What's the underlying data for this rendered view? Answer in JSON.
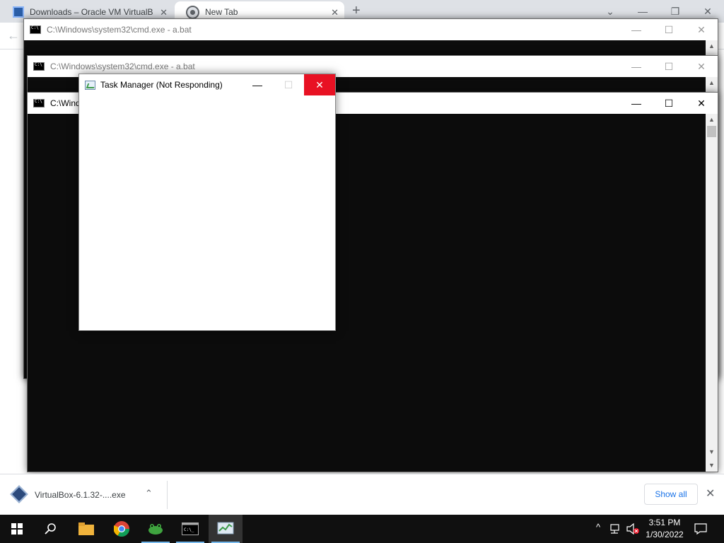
{
  "browser": {
    "tabs": [
      {
        "title": "Downloads – Oracle VM VirtualB",
        "icon": "virtualbox-icon",
        "active": false
      },
      {
        "title": "New Tab",
        "icon": "chrome-icon",
        "active": true
      }
    ],
    "new_tab_symbol": "+",
    "window_controls": {
      "tabsearch": "⌄",
      "minimize": "—",
      "restore": "❐",
      "close": "✕"
    },
    "back_symbol": "←"
  },
  "cmd_windows": [
    {
      "title": "C:\\Windows\\system32\\cmd.exe - a.bat",
      "state": "inactive"
    },
    {
      "title": "C:\\Windows\\system32\\cmd.exe - a.bat",
      "state": "inactive"
    },
    {
      "title": "C:\\Wind",
      "state": "active"
    }
  ],
  "cmd_controls": {
    "minimize": "—",
    "maximize": "☐",
    "close": "✕"
  },
  "task_manager": {
    "title": "Task Manager (Not Responding)",
    "controls": {
      "minimize": "—",
      "maximize": "☐",
      "close": "✕"
    }
  },
  "download_bar": {
    "file_name": "VirtualBox-6.1.32-....exe",
    "chevron": "⌃",
    "show_all": "Show all",
    "close": "✕"
  },
  "taskbar": {
    "apps": [
      "start-icon",
      "search-icon",
      "file-explorer-icon",
      "chrome-icon",
      "frog-app-icon",
      "cmd-icon",
      "task-manager-icon"
    ],
    "tray_chevron": "^",
    "time": "3:51 PM",
    "date": "1/30/2022"
  },
  "colors": {
    "close_red": "#e81123",
    "console_bg": "#0c0c0c",
    "link_blue": "#1a73e8",
    "taskbar": "#101010"
  }
}
